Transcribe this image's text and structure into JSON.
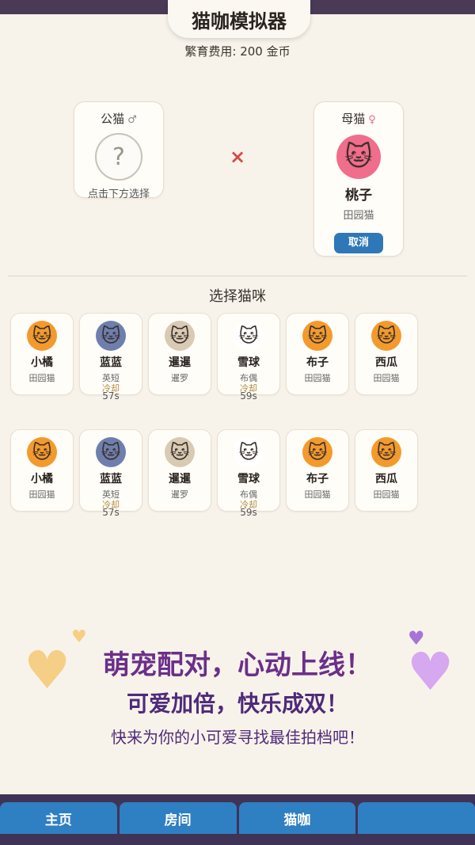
{
  "header": {
    "title": "猫咖模拟器",
    "fee": "繁育费用: 200 金币"
  },
  "male_slot": {
    "label": "公猫",
    "symbol": "♂",
    "placeholder": "?",
    "hint": "点击下方选择"
  },
  "cross": "×",
  "female_slot": {
    "label": "母猫",
    "symbol": "♀",
    "avatar": "🐱",
    "name": "桃子",
    "breed": "田园猫",
    "cancel": "取消"
  },
  "select_title": "选择猫咪",
  "row1": [
    {
      "avatar": "🐱",
      "name": "小橘",
      "breed": "田园猫"
    },
    {
      "avatar": "🐱",
      "name": "蓝蓝",
      "breed": "英短",
      "cooldown": "冷却",
      "time": "57s"
    },
    {
      "avatar": "🐱",
      "name": "暹暹",
      "breed": "暹罗"
    },
    {
      "avatar": "🐱",
      "name": "雪球",
      "breed": "布偶",
      "cooldown": "冷却",
      "time": "59s"
    },
    {
      "avatar": "🐱",
      "name": "布子",
      "breed": "田园猫"
    },
    {
      "avatar": "🐱",
      "name": "西瓜",
      "breed": "田园猫"
    }
  ],
  "row2": [
    {
      "avatar": "🐱",
      "name": "小橘",
      "breed": "田园猫"
    },
    {
      "avatar": "🐱",
      "name": "蓝蓝",
      "breed": "英短",
      "cooldown": "冷却",
      "time": "57s"
    },
    {
      "avatar": "🐱",
      "name": "暹暹",
      "breed": "暹罗"
    },
    {
      "avatar": "🐱",
      "name": "雪球",
      "breed": "布偶",
      "cooldown": "冷却",
      "time": "59s"
    },
    {
      "avatar": "🐱",
      "name": "布子",
      "breed": "田园猫"
    },
    {
      "avatar": "🐱",
      "name": "西瓜",
      "breed": "田园猫"
    }
  ],
  "promo": {
    "line1": "萌宠配对，心动上线！",
    "line2": "可爱加倍，快乐成双！",
    "line3": "快来为你的小可爱寻找最佳拍档吧！",
    "heart": "♥"
  },
  "nav": [
    "主页",
    "房间",
    "猫咖",
    ""
  ]
}
